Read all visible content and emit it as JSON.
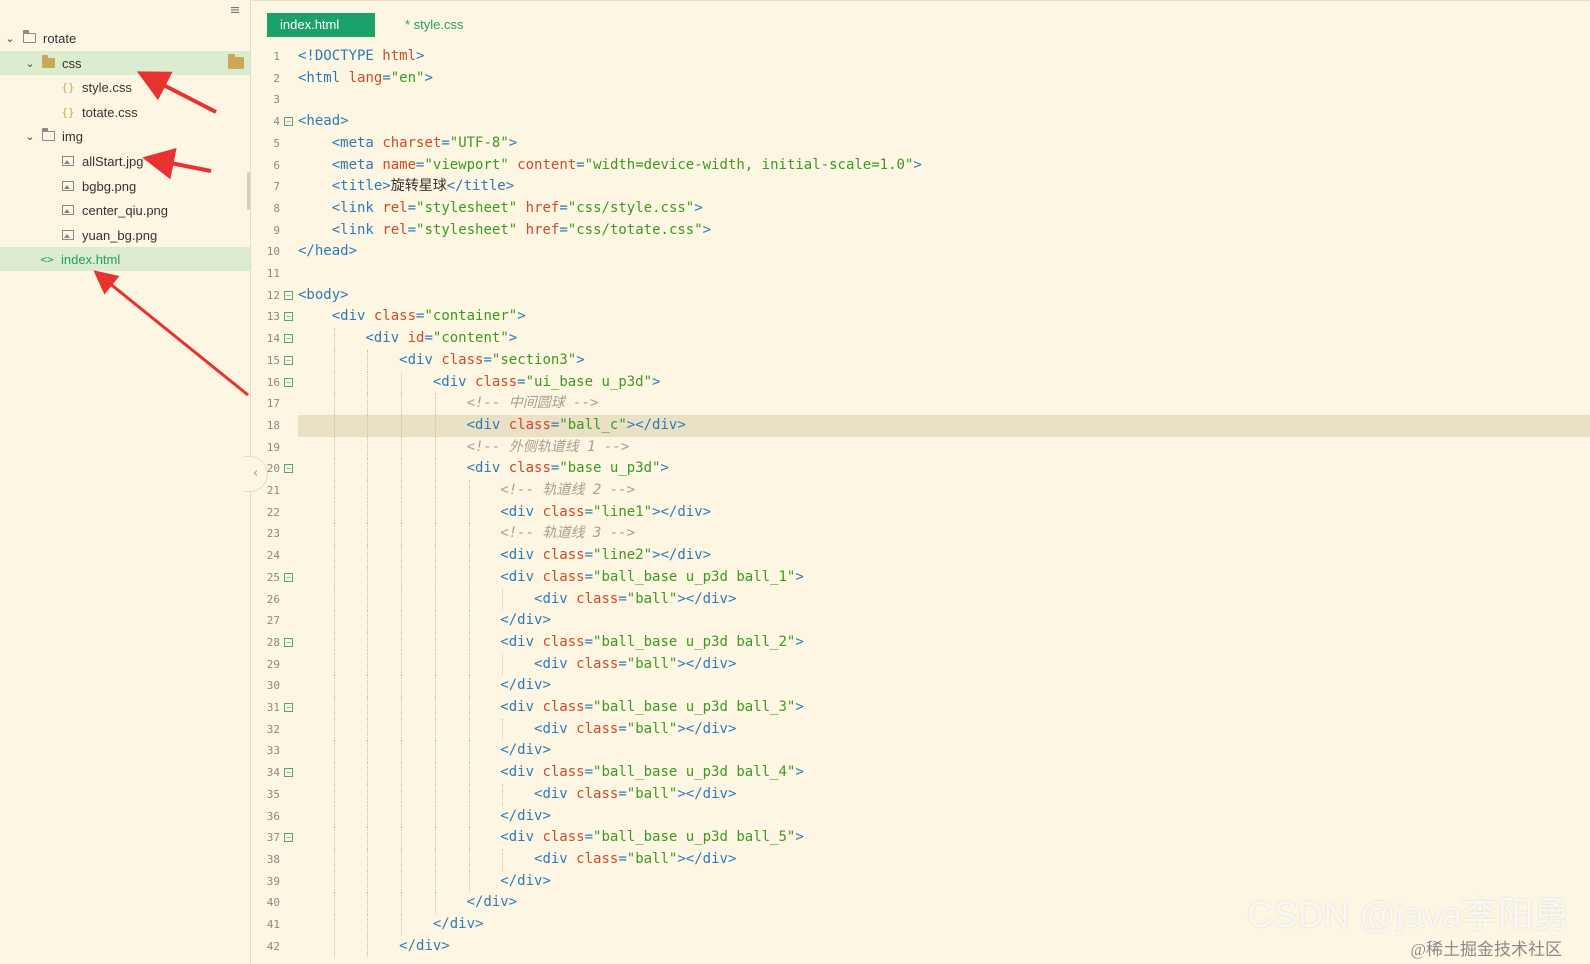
{
  "sidebar": {
    "items": [
      {
        "label": "rotate",
        "kind": "project",
        "expanded": true
      },
      {
        "label": "css",
        "kind": "folder",
        "expanded": true
      },
      {
        "label": "style.css",
        "kind": "css-file"
      },
      {
        "label": "totate.css",
        "kind": "css-file"
      },
      {
        "label": "img",
        "kind": "folder",
        "expanded": true
      },
      {
        "label": "allStart.jpg",
        "kind": "image-file"
      },
      {
        "label": "bgbg.png",
        "kind": "image-file"
      },
      {
        "label": "center_qiu.png",
        "kind": "image-file"
      },
      {
        "label": "yuan_bg.png",
        "kind": "image-file"
      },
      {
        "label": "index.html",
        "kind": "html-file"
      }
    ]
  },
  "tabs": [
    {
      "label": "index.html",
      "active": true
    },
    {
      "label": "* style.css",
      "active": false
    }
  ],
  "editor": {
    "highlighted_line": 18,
    "lines": [
      {
        "n": "1",
        "text": "<!DOCTYPE html>"
      },
      {
        "n": "2",
        "text": "<html lang=\"en\">"
      },
      {
        "n": "3",
        "text": ""
      },
      {
        "n": "4",
        "text": "<head>"
      },
      {
        "n": "5",
        "text": "    <meta charset=\"UTF-8\">"
      },
      {
        "n": "6",
        "text": "    <meta name=\"viewport\" content=\"width=device-width, initial-scale=1.0\">"
      },
      {
        "n": "7",
        "text": "    <title>旋转星球</title>"
      },
      {
        "n": "8",
        "text": "    <link rel=\"stylesheet\" href=\"css/style.css\">"
      },
      {
        "n": "9",
        "text": "    <link rel=\"stylesheet\" href=\"css/totate.css\">"
      },
      {
        "n": "10",
        "text": "</head>"
      },
      {
        "n": "11",
        "text": ""
      },
      {
        "n": "12",
        "text": "<body>"
      },
      {
        "n": "13",
        "text": "    <div class=\"container\">"
      },
      {
        "n": "14",
        "text": "        <div id=\"content\">"
      },
      {
        "n": "15",
        "text": "            <div class=\"section3\">"
      },
      {
        "n": "16",
        "text": "                <div class=\"ui_base u_p3d\">"
      },
      {
        "n": "17",
        "text": "                    <!-- 中间圆球 -->"
      },
      {
        "n": "18",
        "text": "                    <div class=\"ball_c\"></div>"
      },
      {
        "n": "19",
        "text": "                    <!-- 外侧轨道线 1 -->"
      },
      {
        "n": "20",
        "text": "                    <div class=\"base u_p3d\">"
      },
      {
        "n": "21",
        "text": "                        <!-- 轨道线 2 -->"
      },
      {
        "n": "22",
        "text": "                        <div class=\"line1\"></div>"
      },
      {
        "n": "23",
        "text": "                        <!-- 轨道线 3 -->"
      },
      {
        "n": "24",
        "text": "                        <div class=\"line2\"></div>"
      },
      {
        "n": "25",
        "text": "                        <div class=\"ball_base u_p3d ball_1\">"
      },
      {
        "n": "26",
        "text": "                            <div class=\"ball\"></div>"
      },
      {
        "n": "27",
        "text": "                        </div>"
      },
      {
        "n": "28",
        "text": "                        <div class=\"ball_base u_p3d ball_2\">"
      },
      {
        "n": "29",
        "text": "                            <div class=\"ball\"></div>"
      },
      {
        "n": "30",
        "text": "                        </div>"
      },
      {
        "n": "31",
        "text": "                        <div class=\"ball_base u_p3d ball_3\">"
      },
      {
        "n": "32",
        "text": "                            <div class=\"ball\"></div>"
      },
      {
        "n": "33",
        "text": "                        </div>"
      },
      {
        "n": "34",
        "text": "                        <div class=\"ball_base u_p3d ball_4\">"
      },
      {
        "n": "35",
        "text": "                            <div class=\"ball\"></div>"
      },
      {
        "n": "36",
        "text": "                        </div>"
      },
      {
        "n": "37",
        "text": "                        <div class=\"ball_base u_p3d ball_5\">"
      },
      {
        "n": "38",
        "text": "                            <div class=\"ball\"></div>"
      },
      {
        "n": "39",
        "text": "                        </div>"
      },
      {
        "n": "40",
        "text": "                    </div>"
      },
      {
        "n": "41",
        "text": "                </div>"
      },
      {
        "n": "42",
        "text": "            </div>"
      }
    ],
    "fold_lines": [
      "4",
      "12",
      "13",
      "14",
      "15",
      "16",
      "20",
      "25",
      "28",
      "31",
      "34",
      "37"
    ]
  },
  "watermark": {
    "text": "CSDN @java李阳勇",
    "subtext": "@稀土掘金技术社区"
  },
  "colors": {
    "background": "#fdf6e3",
    "tab_active": "#1ba26b",
    "selection": "#dbeccf",
    "tag": "#2c7bb6",
    "attribute": "#cc4b29",
    "string": "#3b9a1f",
    "comment": "#a89f8a",
    "annotation_arrow": "#e8322f"
  }
}
